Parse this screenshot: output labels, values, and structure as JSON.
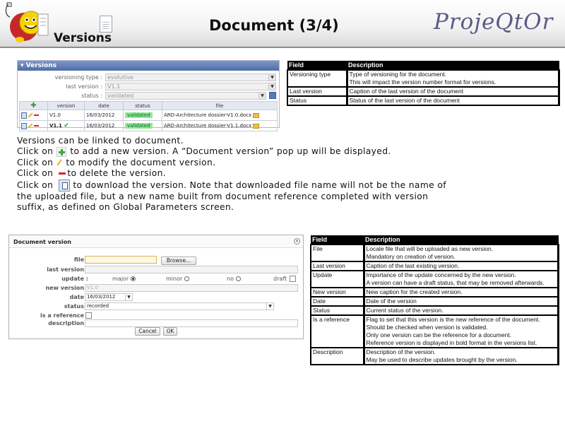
{
  "header": {
    "section": "Versions",
    "title": "Document (3/4)",
    "brand": "ProjeQtOr"
  },
  "versions_panel": {
    "title": "Versions",
    "fields": [
      {
        "label": "versioning type :",
        "value": "evolutive"
      },
      {
        "label": "last version :",
        "value": "V1.1"
      },
      {
        "label": "status :",
        "value": "validated"
      }
    ],
    "columns": [
      "version",
      "date",
      "status",
      "file"
    ],
    "rows": [
      {
        "version": "V1.0",
        "date": "16/03/2012",
        "status": "validated",
        "file": "ARD-Architecture dossier-V1.0.docx"
      },
      {
        "version": "V1.1",
        "date": "16/03/2012",
        "status": "validated",
        "file": "ARD-Architecture dossier-V1.1.docx"
      }
    ]
  },
  "table1": {
    "headers": [
      "Field",
      "Description"
    ],
    "rows": [
      {
        "field": "Versioning type",
        "desc1": "Type of versioning for the document.",
        "desc2": "This will impact the version number format for versions."
      },
      {
        "field": "Last version",
        "desc1": "Caption of the last version of the document"
      },
      {
        "field": "Status",
        "desc1": "Status of the last version of the document"
      }
    ]
  },
  "body": {
    "line1": "Versions can be linked to document.",
    "line2a": "Click on",
    "line2b": "to add a new version. A “Document version” pop up will be displayed.",
    "line3a": "Click on",
    "line3b": "to modify the document version.",
    "line4a": "Click on",
    "line4b": "to delete the version.",
    "line5a": "Click on",
    "line5b": "to download the version. Note that downloaded file name will not be the name of the uploaded file, but a new name built from document reference completed with version suffix, as defined on Global Parameters screen."
  },
  "dialog": {
    "title": "Document version",
    "labels": {
      "file": "file :",
      "last_version": "last version :",
      "update": "update :",
      "new_version": "new version :",
      "date": "date :",
      "status": "status :",
      "reference": "is a reference :",
      "description": "description :"
    },
    "browse": "Browse...",
    "update_options": [
      "major",
      "minor",
      "no",
      "draft"
    ],
    "new_version_value": "V1.0",
    "date_value": "16/03/2012",
    "status_value": "recorded",
    "cancel": "Cancel",
    "ok": "OK"
  },
  "table2": {
    "headers": [
      "Field",
      "Description"
    ],
    "rows": [
      {
        "field": "File",
        "lines": [
          "Locale file that will be uploaded  as new version.",
          "Mandatory on creation of version."
        ]
      },
      {
        "field": "Last version",
        "lines": [
          "Caption of the last existing version."
        ]
      },
      {
        "field": "Update",
        "lines": [
          "Importance of the update concerned by the new version.",
          "A version can have a draft status, that may be removed afterwards."
        ]
      },
      {
        "field": "New version",
        "lines": [
          "New caption for the created version."
        ]
      },
      {
        "field": "Date",
        "lines": [
          "Date of the version"
        ]
      },
      {
        "field": "Status",
        "lines": [
          "Current status of the version."
        ]
      },
      {
        "field": "Is a reference",
        "lines": [
          "Flag to set that this version is the new reference of the document. Should be checked when version is validated.",
          "Only one version can be the reference for a document.",
          "Reference version is displayed in  bold format in the versions list."
        ]
      },
      {
        "field": "Description",
        "lines": [
          "Description of the version.",
          "May be used to describe updates brought by the version."
        ]
      }
    ]
  }
}
